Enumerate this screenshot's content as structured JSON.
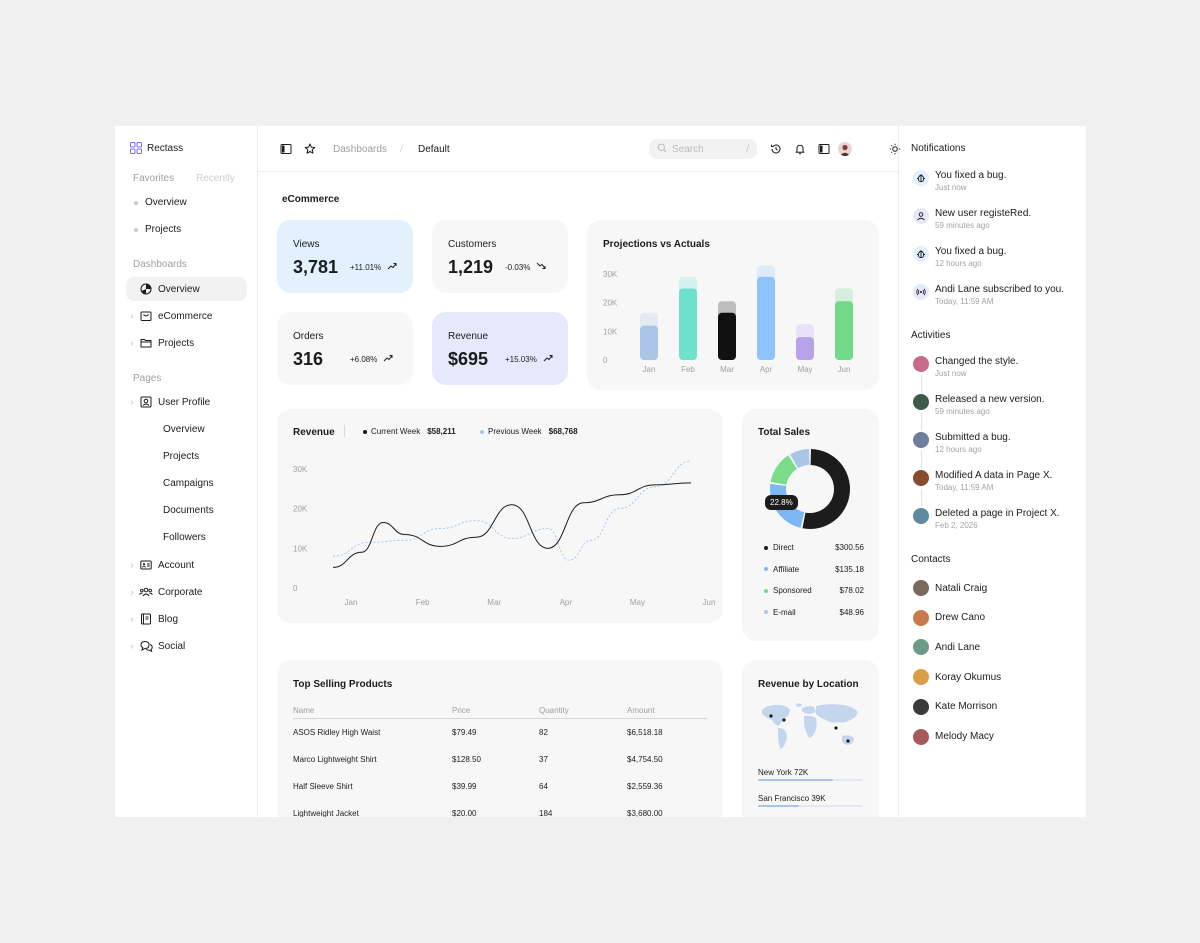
{
  "brand": {
    "name": "Rectass"
  },
  "sidebar": {
    "tabs": {
      "favorites": "Favorites",
      "recently": "Recently"
    },
    "favorites": [
      {
        "label": "Overview"
      },
      {
        "label": "Projects"
      }
    ],
    "dashboards_heading": "Dashboards",
    "dashboards": [
      {
        "label": "Overview",
        "icon": "pie-chart-icon",
        "active": true
      },
      {
        "label": "eCommerce",
        "icon": "shopping-bag-icon"
      },
      {
        "label": "Projects",
        "icon": "folder-icon"
      }
    ],
    "pages_heading": "Pages",
    "pages": [
      {
        "label": "User Profile",
        "icon": "user-profile-icon"
      },
      {
        "label": "Overview"
      },
      {
        "label": "Projects"
      },
      {
        "label": "Campaigns"
      },
      {
        "label": "Documents"
      },
      {
        "label": "Followers"
      },
      {
        "label": "Account",
        "icon": "id-card-icon"
      },
      {
        "label": "Corporate",
        "icon": "users-icon"
      },
      {
        "label": "Blog",
        "icon": "notebook-icon"
      },
      {
        "label": "Social",
        "icon": "chat-icon"
      }
    ]
  },
  "topbar": {
    "breadcrumb": {
      "parent": "Dashboards",
      "separator": "/",
      "current": "Default"
    },
    "search": {
      "placeholder": "Search",
      "shortcut": "/"
    }
  },
  "main": {
    "section_title": "eCommerce",
    "kpis": [
      {
        "title": "Views",
        "value": "3,781",
        "delta": "+11.01%",
        "bg": "#e3f0fd"
      },
      {
        "title": "Customers",
        "value": "1,219",
        "delta": "-0.03%",
        "bg": "#f7f7f8"
      },
      {
        "title": "Orders",
        "value": "316",
        "delta": "+6.08%",
        "bg": "#f7f7f8"
      },
      {
        "title": "Revenue",
        "value": "$695",
        "delta": "+15.03%",
        "bg": "#e6e9fb"
      }
    ]
  },
  "chart_data": [
    {
      "type": "bar",
      "title": "Projections vs Actuals",
      "categories": [
        "Jan",
        "Feb",
        "Mar",
        "Apr",
        "May",
        "Jun"
      ],
      "yticks": [
        "0",
        "10K",
        "20K",
        "30K"
      ],
      "ylim": [
        0,
        30000
      ],
      "series": [
        {
          "values": [
            12000,
            25000,
            16500,
            29000,
            8000,
            20500
          ]
        },
        {
          "values": [
            16500,
            29000,
            20500,
            33000,
            12500,
            25000
          ]
        }
      ],
      "colors": [
        "#a8c5e8",
        "#6fe0cc",
        "#111111",
        "#8fc3ff",
        "#b8a3eb",
        "#72d98a"
      ]
    },
    {
      "type": "line",
      "title": "Revenue",
      "legend": [
        {
          "name": "Current Week",
          "value": "$58,211",
          "color": "#1c1c1c"
        },
        {
          "name": "Previous Week",
          "value": "$68,768",
          "color": "#a8c5e8"
        }
      ],
      "categories": [
        "Jan",
        "Feb",
        "Mar",
        "Apr",
        "May",
        "Jun"
      ],
      "yticks": [
        "0",
        "10K",
        "20K",
        "30K"
      ],
      "ylim": [
        0,
        30000
      ],
      "series": [
        {
          "name": "Current Week",
          "x": [
            0,
            0.4,
            0.7,
            1.0,
            1.5,
            2.0,
            2.5,
            3.0,
            3.5,
            4.0,
            4.5,
            5.0
          ],
          "y": [
            5200,
            9000,
            16500,
            13500,
            10500,
            12800,
            21000,
            10000,
            21500,
            23500,
            26000,
            26500
          ]
        },
        {
          "name": "Previous Week",
          "x": [
            0,
            0.5,
            1.0,
            1.5,
            2.0,
            2.5,
            3.0,
            3.3,
            3.6,
            4.0,
            4.5,
            5.0
          ],
          "y": [
            8000,
            11500,
            12000,
            15000,
            17000,
            12500,
            15000,
            7000,
            12000,
            20000,
            25500,
            32000
          ]
        }
      ]
    },
    {
      "type": "pie",
      "title": "Total Sales",
      "callout": "22.8%",
      "slices": [
        {
          "label": "Direct",
          "value": 300.56,
          "display": "$300.56",
          "color": "#1c1c1c"
        },
        {
          "label": "Affiliate",
          "value": 135.18,
          "display": "$135.18",
          "color": "#7db7f5"
        },
        {
          "label": "Sponsored",
          "value": 78.02,
          "display": "$78.02",
          "color": "#7bdc8b"
        },
        {
          "label": "E-mail",
          "value": 48.96,
          "display": "$48.96",
          "color": "#a8c5e8"
        }
      ]
    }
  ],
  "top_selling": {
    "title": "Top Selling Products",
    "columns": [
      "Name",
      "Price",
      "Quantity",
      "Amount"
    ],
    "rows": [
      [
        "ASOS Ridley High Waist",
        "$79.49",
        "82",
        "$6,518.18"
      ],
      [
        "Marco Lightweight Shirt",
        "$128.50",
        "37",
        "$4,754.50"
      ],
      [
        "Half Sleeve  Shirt",
        "$39.99",
        "64",
        "$2,559.36"
      ],
      [
        "Lightweight Jacket",
        "$20.00",
        "184",
        "$3,680.00"
      ]
    ]
  },
  "location": {
    "title": "Revenue by Location",
    "items": [
      {
        "label": "New York 72K",
        "fill": 0.72
      },
      {
        "label": "San Francisco 39K",
        "fill": 0.39
      }
    ]
  },
  "notifications": {
    "title": "Notifications",
    "items": [
      {
        "text": "You fixed a bug.",
        "time": "Just now",
        "icon": "bug-icon",
        "bg": "#e3f0fd"
      },
      {
        "text": "New user registeRed.",
        "time": "59 minutes ago",
        "icon": "user-icon",
        "bg": "#e6e9fb"
      },
      {
        "text": "You fixed a bug.",
        "time": "12 hours ago",
        "icon": "bug-icon",
        "bg": "#e3f0fd"
      },
      {
        "text": "Andi Lane subscribed to you.",
        "time": "Today, 11:59 AM",
        "icon": "broadcast-icon",
        "bg": "#e6e9fb"
      }
    ]
  },
  "activities": {
    "title": "Activities",
    "items": [
      {
        "text": "Changed the style.",
        "time": "Just now",
        "color": "#c86b8a"
      },
      {
        "text": "Released a new version.",
        "time": "59 minutes ago",
        "color": "#3d5a4a"
      },
      {
        "text": "Submitted a bug.",
        "time": "12 hours ago",
        "color": "#6f7f9a"
      },
      {
        "text": "Modified A data in Page X.",
        "time": "Today, 11:59 AM",
        "color": "#8a4a2e"
      },
      {
        "text": "Deleted a page in Project X.",
        "time": "Feb 2, 2026",
        "color": "#5f8aa0"
      }
    ]
  },
  "contacts": {
    "title": "Contacts",
    "items": [
      {
        "name": "Natali Craig",
        "color": "#7a6a60"
      },
      {
        "name": "Drew Cano",
        "color": "#c97a4a"
      },
      {
        "name": "Andi Lane",
        "color": "#6e9a8a"
      },
      {
        "name": "Koray Okumus",
        "color": "#d9a04a"
      },
      {
        "name": "Kate Morrison",
        "color": "#3a3a3a"
      },
      {
        "name": "Melody Macy",
        "color": "#a65a5a"
      }
    ]
  }
}
